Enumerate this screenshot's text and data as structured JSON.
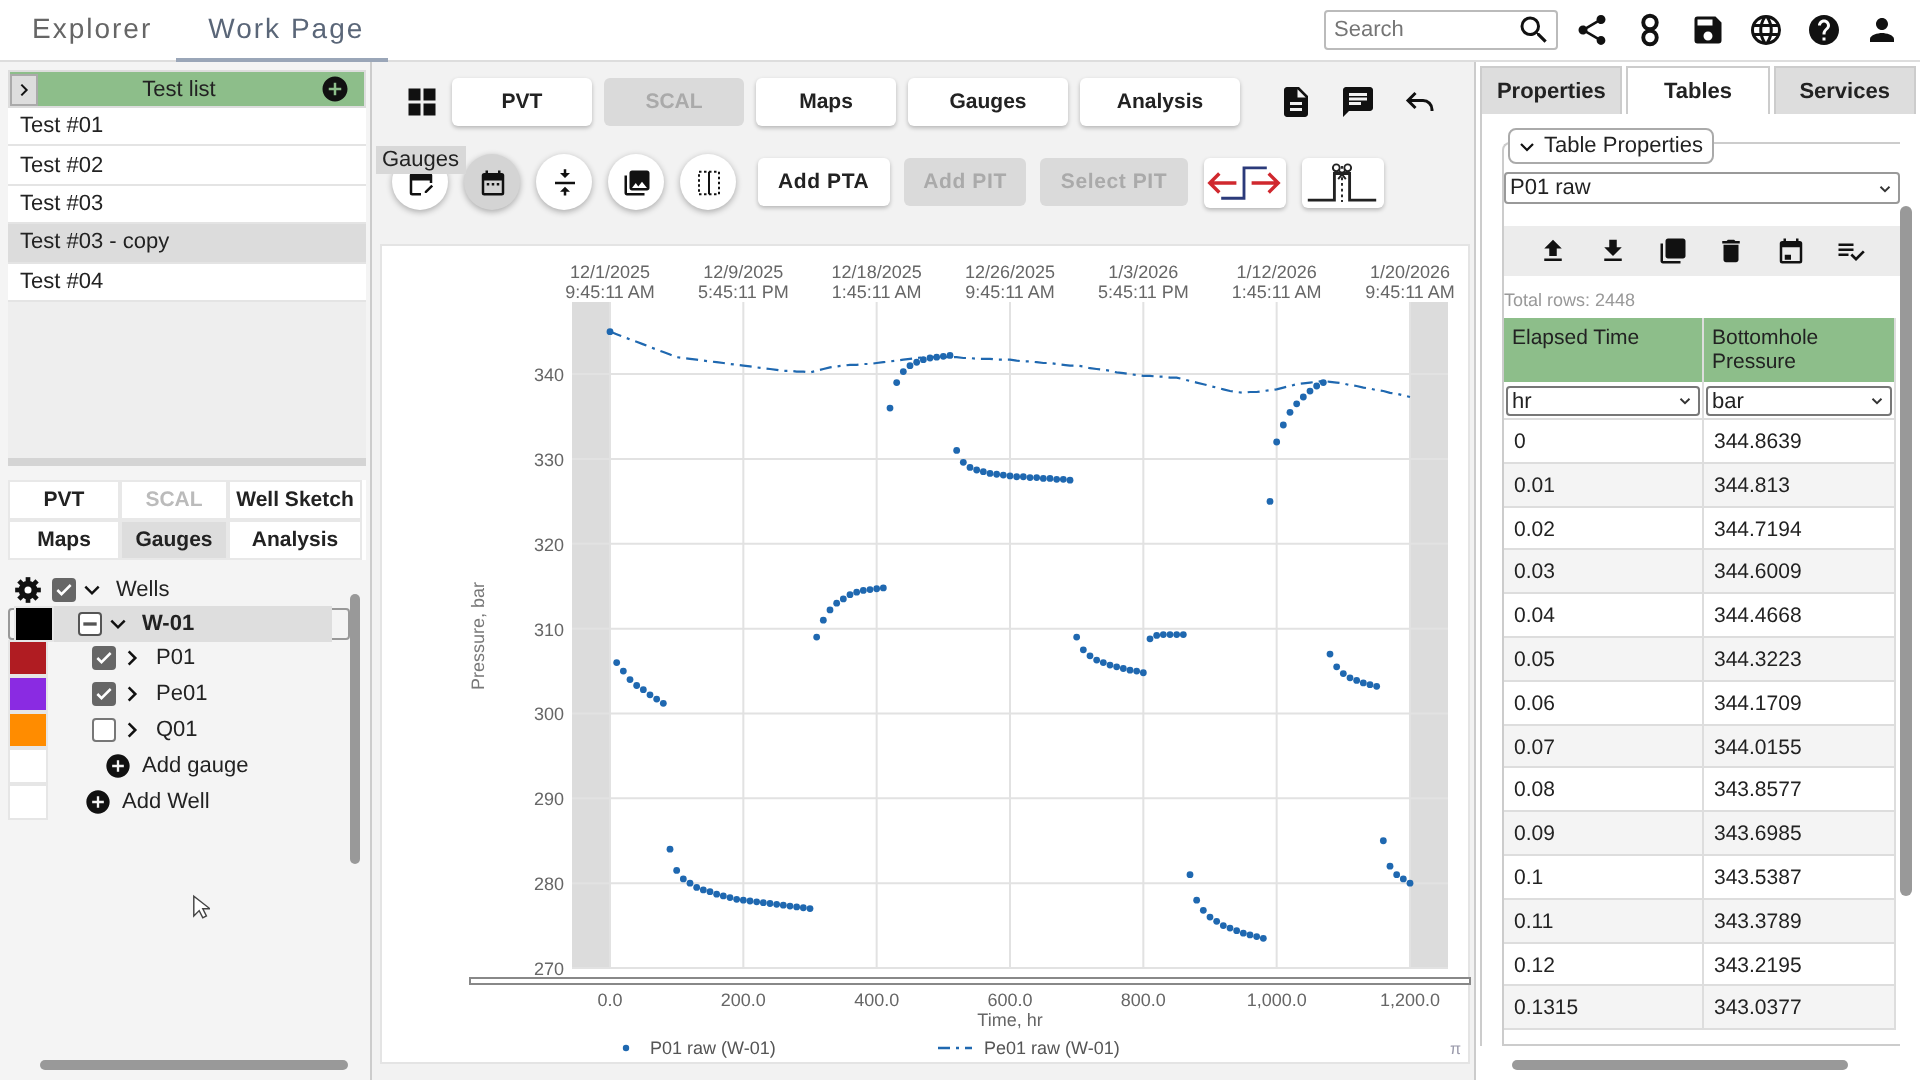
{
  "top_bar": {
    "tabs": [
      {
        "label": "Explorer",
        "selected": false
      },
      {
        "label": "Work Page",
        "selected": true
      }
    ],
    "search": {
      "placeholder": "Search"
    }
  },
  "test_list": {
    "title": "Test list",
    "items": [
      {
        "label": "Test #01",
        "selected": false
      },
      {
        "label": "Test #02",
        "selected": false
      },
      {
        "label": "Test #03",
        "selected": false
      },
      {
        "label": "Test #03 - copy",
        "selected": true
      },
      {
        "label": "Test #04",
        "selected": false
      }
    ]
  },
  "left_tabs": [
    {
      "label": "PVT",
      "selected": false,
      "disabled": false
    },
    {
      "label": "SCAL",
      "selected": false,
      "disabled": true
    },
    {
      "label": "Well Sketch",
      "selected": false,
      "disabled": false
    },
    {
      "label": "Maps",
      "selected": false,
      "disabled": false
    },
    {
      "label": "Gauges",
      "selected": true,
      "disabled": false
    },
    {
      "label": "Analysis",
      "selected": false,
      "disabled": false
    }
  ],
  "tree": {
    "label": "Wells",
    "checked": true,
    "expanded": true,
    "children": [
      {
        "label": "W-01",
        "color": "#000000",
        "indeterminate": true,
        "expanded": true,
        "selected": true,
        "add_label": "Add gauge",
        "children": [
          {
            "label": "P01",
            "color": "#b01c22",
            "checked": true,
            "expanded": false,
            "selected": false
          },
          {
            "label": "Pe01",
            "color": "#8a2be2",
            "checked": true,
            "expanded": false,
            "selected": false
          },
          {
            "label": "Q01",
            "color": "#ff8c00",
            "checked": false,
            "expanded": false,
            "selected": false
          }
        ]
      }
    ],
    "add_label": "Add Well"
  },
  "nav_buttons": [
    {
      "label": "PVT",
      "disabled": false
    },
    {
      "label": "SCAL",
      "disabled": true
    },
    {
      "label": "Maps",
      "disabled": false
    },
    {
      "label": "Gauges",
      "disabled": false
    },
    {
      "label": "Analysis",
      "disabled": false
    }
  ],
  "tooltip": "Gauges",
  "round_tools": [
    {
      "selected": false
    },
    {
      "selected": true
    },
    {
      "selected": false
    },
    {
      "selected": false
    },
    {
      "selected": false
    }
  ],
  "action_buttons": [
    {
      "label": "Add PTA",
      "disabled": false
    },
    {
      "label": "Add PIT",
      "disabled": true
    },
    {
      "label": "Select PIT",
      "disabled": true
    }
  ],
  "chart": {
    "top_ticks": [
      {
        "date": "12/1/2025",
        "time": "9:45:11 AM"
      },
      {
        "date": "12/9/2025",
        "time": "5:45:11 PM"
      },
      {
        "date": "12/18/2025",
        "time": "1:45:11 AM"
      },
      {
        "date": "12/26/2025",
        "time": "9:45:11 AM"
      },
      {
        "date": "1/3/2026",
        "time": "5:45:11 PM"
      },
      {
        "date": "1/12/2026",
        "time": "1:45:11 AM"
      },
      {
        "date": "1/20/2026",
        "time": "9:45:11 AM"
      }
    ],
    "corner_mark": "π",
    "chart_data": {
      "type": "scatter",
      "grid": true,
      "legend": true,
      "xlabel": "Time, hr",
      "ylabel": "Pressure, bar",
      "xlim": [
        -57,
        1257
      ],
      "ylim": [
        270,
        348.5
      ],
      "xticks": [
        {
          "value": 0,
          "label": "0.0"
        },
        {
          "value": 200,
          "label": "200.0"
        },
        {
          "value": 400,
          "label": "400.0"
        },
        {
          "value": 600,
          "label": "600.0"
        },
        {
          "value": 800,
          "label": "800.0"
        },
        {
          "value": 1000,
          "label": "1,000.0"
        },
        {
          "value": 1200,
          "label": "1,200.0"
        }
      ],
      "yticks": [
        270,
        280,
        290,
        300,
        310,
        320,
        330,
        340
      ],
      "x": [
        0,
        10,
        20,
        30,
        40,
        50,
        60,
        70,
        80,
        90,
        100,
        110,
        120,
        130,
        140,
        150,
        160,
        170,
        180,
        190,
        200,
        210,
        220,
        230,
        240,
        250,
        260,
        270,
        280,
        290,
        300,
        310,
        320,
        330,
        340,
        350,
        360,
        370,
        380,
        390,
        400,
        410,
        420,
        430,
        440,
        450,
        460,
        470,
        480,
        490,
        500,
        510,
        520,
        530,
        540,
        550,
        560,
        570,
        580,
        590,
        600,
        610,
        620,
        630,
        640,
        650,
        660,
        670,
        680,
        690,
        700,
        710,
        720,
        730,
        740,
        750,
        760,
        770,
        780,
        790,
        800,
        810,
        820,
        830,
        840,
        850,
        860,
        870,
        880,
        890,
        900,
        910,
        920,
        930,
        940,
        950,
        960,
        970,
        980,
        990,
        1000,
        1010,
        1020,
        1030,
        1040,
        1050,
        1060,
        1070,
        1080,
        1090,
        1100,
        1110,
        1120,
        1130,
        1140,
        1150,
        1160,
        1170,
        1180,
        1190,
        1200
      ],
      "series": [
        {
          "name": "P01 raw (W-01)",
          "type": "scatter",
          "color": "#1f68b0",
          "values": [
            345,
            306,
            305,
            304,
            303.3,
            302.8,
            302.2,
            301.7,
            301.2,
            284,
            281.5,
            280.5,
            280,
            279.5,
            279.2,
            279,
            278.7,
            278.5,
            278.3,
            278.1,
            278,
            277.9,
            277.8,
            277.7,
            277.6,
            277.5,
            277.4,
            277.3,
            277.2,
            277.1,
            277,
            309,
            311,
            312.2,
            313,
            313.5,
            314,
            314.3,
            314.5,
            314.6,
            314.7,
            314.8,
            336,
            339,
            340.3,
            341,
            341.4,
            341.7,
            341.9,
            342,
            342.1,
            342.2,
            331,
            329.6,
            329,
            328.7,
            328.5,
            328.3,
            328.2,
            328.1,
            328,
            327.9,
            327.9,
            327.8,
            327.8,
            327.7,
            327.7,
            327.6,
            327.6,
            327.5,
            309,
            307.5,
            306.8,
            306.3,
            306,
            305.7,
            305.5,
            305.3,
            305.1,
            305,
            304.8,
            308.8,
            309.2,
            309.3,
            309.3,
            309.3,
            309.3,
            281,
            278,
            276.8,
            276,
            275.5,
            275,
            274.7,
            274.4,
            274.1,
            273.9,
            273.7,
            273.5,
            325,
            332,
            334,
            335.5,
            336.5,
            337.3,
            338,
            338.6,
            339,
            307,
            305.5,
            304.7,
            304.2,
            303.9,
            303.6,
            303.4,
            303.2,
            285,
            282,
            281,
            280.5,
            280
          ]
        },
        {
          "name": "Pe01 raw (W-01)",
          "type": "line",
          "line_style": "dashdot",
          "color": "#1f68b0",
          "values": [
            345,
            344.7,
            344.4,
            344.1,
            343.8,
            343.5,
            343.2,
            342.9,
            342.6,
            342.3,
            342,
            341.9,
            341.8,
            341.7,
            341.6,
            341.5,
            341.4,
            341.3,
            341.2,
            341.1,
            341,
            340.9,
            340.8,
            340.7,
            340.6,
            340.5,
            340.4,
            340.4,
            340.3,
            340.3,
            340.2,
            340.4,
            340.6,
            340.8,
            340.9,
            341,
            341.1,
            341.1,
            341.2,
            341.2,
            341.3,
            341.4,
            341.5,
            341.6,
            341.7,
            341.8,
            341.9,
            342,
            342,
            342,
            342,
            342,
            342,
            341.9,
            341.9,
            341.8,
            341.8,
            341.8,
            341.7,
            341.7,
            341.7,
            341.6,
            341.5,
            341.5,
            341.4,
            341.3,
            341.3,
            341.2,
            341.1,
            341,
            341,
            340.9,
            340.7,
            340.6,
            340.5,
            340.4,
            340.2,
            340.1,
            340,
            339.9,
            339.8,
            339.8,
            339.7,
            339.7,
            339.6,
            339.6,
            339.4,
            339.2,
            339,
            338.8,
            338.6,
            338.4,
            338.2,
            338,
            337.9,
            337.8,
            337.9,
            337.9,
            338,
            338.1,
            338.2,
            338.4,
            338.6,
            338.8,
            338.9,
            339,
            339.1,
            339.2,
            339.1,
            339,
            338.9,
            338.7,
            338.6,
            338.4,
            338.3,
            338.1,
            338,
            337.8,
            337.7,
            337.5,
            337.3
          ]
        }
      ]
    }
  },
  "right_tabs": [
    {
      "label": "Properties",
      "selected": false
    },
    {
      "label": "Tables",
      "selected": true
    },
    {
      "label": "Services",
      "selected": false
    }
  ],
  "table_panel": {
    "title": "Table Properties",
    "expanded": true,
    "source": "P01 raw",
    "total_rows": "Total rows: 2448",
    "columns": [
      {
        "title": "Elapsed Time",
        "unit": "hr"
      },
      {
        "title": "Bottomhole Pressure",
        "unit": "bar"
      }
    ],
    "rows": [
      [
        "0",
        "344.8639"
      ],
      [
        "0.01",
        "344.813"
      ],
      [
        "0.02",
        "344.7194"
      ],
      [
        "0.03",
        "344.6009"
      ],
      [
        "0.04",
        "344.4668"
      ],
      [
        "0.05",
        "344.3223"
      ],
      [
        "0.06",
        "344.1709"
      ],
      [
        "0.07",
        "344.0155"
      ],
      [
        "0.08",
        "343.8577"
      ],
      [
        "0.09",
        "343.6985"
      ],
      [
        "0.1",
        "343.5387"
      ],
      [
        "0.11",
        "343.3789"
      ],
      [
        "0.12",
        "343.2195"
      ],
      [
        "0.1315",
        "343.0377"
      ]
    ]
  }
}
